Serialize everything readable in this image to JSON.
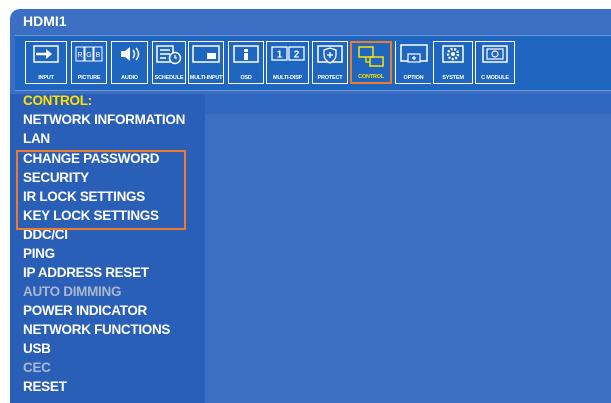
{
  "title": "HDMI1",
  "toolbar": [
    {
      "label": "INPUT",
      "icon": "input-icon"
    },
    {
      "label": "PICTURE",
      "icon": "picture-icon"
    },
    {
      "label": "AUDIO",
      "icon": "audio-icon"
    },
    {
      "label": "SCHEDULE",
      "icon": "schedule-icon"
    },
    {
      "label": "MULTI-INPUT",
      "icon": "multi-input-icon"
    },
    {
      "label": "OSD",
      "icon": "osd-icon"
    },
    {
      "label": "MULTI-DISP",
      "icon": "multi-disp-icon"
    },
    {
      "label": "PROTECT",
      "icon": "protect-icon"
    },
    {
      "label": "CONTROL",
      "icon": "control-icon",
      "active": true
    },
    {
      "label": "OPTION",
      "icon": "option-icon"
    },
    {
      "label": "SYSTEM",
      "icon": "system-icon"
    },
    {
      "label": "C MODULE",
      "icon": "c-module-icon"
    }
  ],
  "picture_letters": [
    "R",
    "G",
    "B"
  ],
  "multi_disp_digits": [
    "1",
    "2"
  ],
  "menu": {
    "heading": "CONTROL:",
    "items": [
      {
        "label": "NETWORK INFORMATION",
        "enabled": true
      },
      {
        "label": "LAN",
        "enabled": true
      },
      {
        "label": "CHANGE PASSWORD",
        "enabled": true
      },
      {
        "label": "SECURITY",
        "enabled": true
      },
      {
        "label": "IR LOCK SETTINGS",
        "enabled": true
      },
      {
        "label": "KEY LOCK SETTINGS",
        "enabled": true
      },
      {
        "label": "DDC/CI",
        "enabled": true
      },
      {
        "label": "PING",
        "enabled": true
      },
      {
        "label": "IP ADDRESS RESET",
        "enabled": true
      },
      {
        "label": "AUTO DIMMING",
        "enabled": false
      },
      {
        "label": "POWER INDICATOR",
        "enabled": true
      },
      {
        "label": "NETWORK FUNCTIONS",
        "enabled": true
      },
      {
        "label": "USB",
        "enabled": true
      },
      {
        "label": "CEC",
        "enabled": false
      },
      {
        "label": "RESET",
        "enabled": true
      }
    ]
  },
  "colors": {
    "accent_highlight": "#ef7a28",
    "selected_text": "#ffe100",
    "disabled_text": "#a9b7cf"
  }
}
